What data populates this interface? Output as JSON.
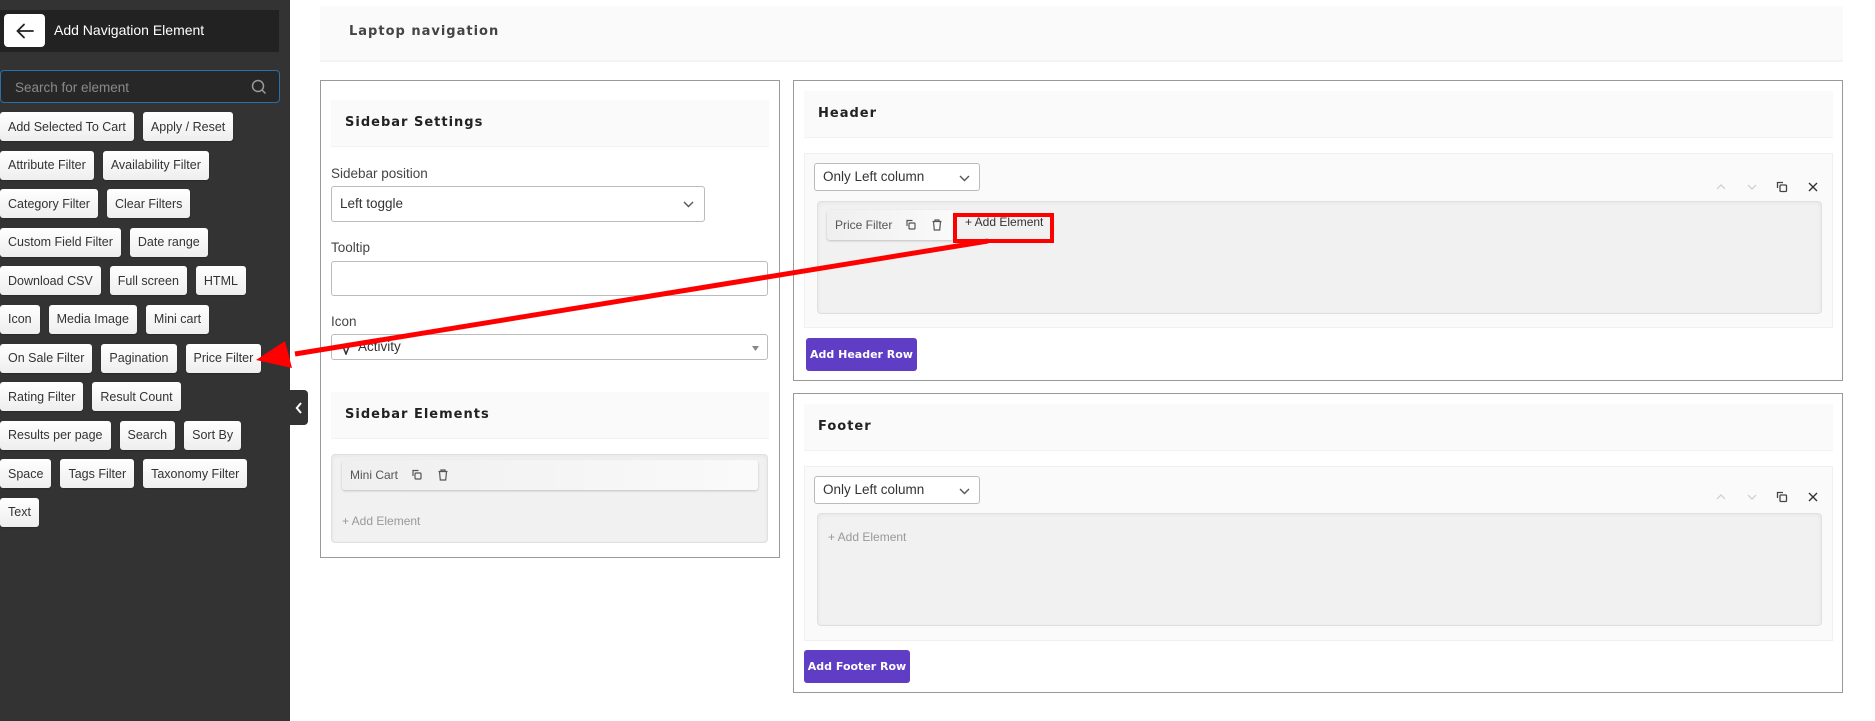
{
  "sidebar": {
    "title": "Add Navigation Element",
    "back_icon": "arrow-left-icon",
    "search": {
      "placeholder": "Search for element",
      "value": "",
      "icon": "search-icon"
    },
    "rows": [
      [
        "Add Selected To Cart",
        "Apply / Reset"
      ],
      [
        "Attribute Filter",
        "Availability Filter"
      ],
      [
        "Category Filter",
        "Clear Filters"
      ],
      [
        "Custom Field Filter",
        "Date range"
      ],
      [
        "Download CSV",
        "Full screen",
        "HTML"
      ],
      [
        "Icon",
        "Media Image",
        "Mini cart"
      ],
      [
        "On Sale Filter",
        "Pagination",
        "Price Filter"
      ],
      [
        "Rating Filter",
        "Result Count"
      ],
      [
        "Results per page",
        "Search",
        "Sort By"
      ],
      [
        "Space",
        "Tags Filter",
        "Taxonomy Filter"
      ],
      [
        "Text"
      ]
    ],
    "collapse_icon": "chevron-left-icon"
  },
  "main": {
    "title": "Laptop navigation",
    "sidebar_settings": {
      "title": "Sidebar Settings",
      "position_label": "Sidebar position",
      "position_value": "Left toggle",
      "tooltip_label": "Tooltip",
      "tooltip_value": "",
      "icon_label": "Icon",
      "icon_value": "Activity",
      "icon_glyph": "activity-icon"
    },
    "sidebar_elements": {
      "title": "Sidebar Elements",
      "items": [
        {
          "label": "Mini Cart"
        }
      ],
      "add_label": "+ Add Element"
    },
    "header": {
      "title": "Header",
      "layout_value": "Only Left column",
      "items": [
        {
          "label": "Price Filter"
        }
      ],
      "add_label": "+ Add Element",
      "add_row_label": "Add Header Row"
    },
    "footer": {
      "title": "Footer",
      "layout_value": "Only Left column",
      "items": [],
      "add_label": "+ Add Element",
      "add_row_label": "Add Footer Row"
    }
  },
  "colors": {
    "sidebar_bg": "#333333",
    "accent_purple": "#5f3dc4",
    "annotation_red": "#ff0000",
    "search_border": "#2d6fa8"
  }
}
